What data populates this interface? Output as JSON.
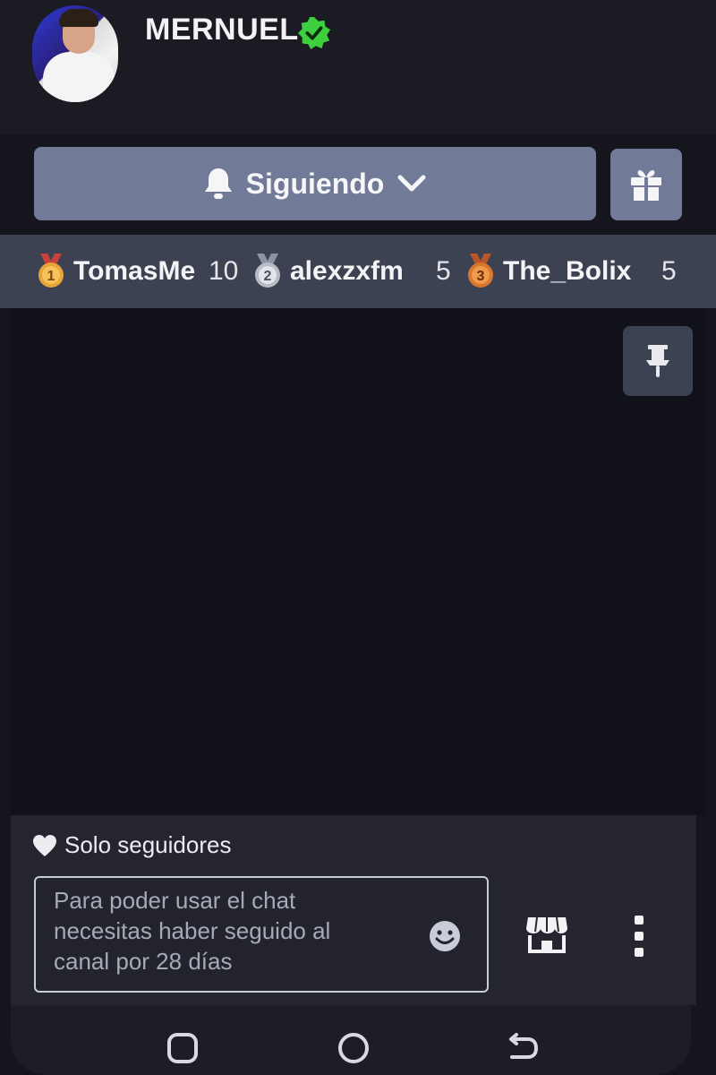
{
  "header": {
    "channel_name": "MERNUEL",
    "verified": true,
    "accent_verified": "#3ecf3e"
  },
  "follow": {
    "label": "Siguiendo",
    "button_color": "#717a97"
  },
  "leaderboard": [
    {
      "rank": 1,
      "name": "TomasMe",
      "count": "10",
      "medal_color": "#e8a43a"
    },
    {
      "rank": 2,
      "name": "alexzxfm",
      "count": "5",
      "medal_color": "#b8bcc6"
    },
    {
      "rank": 3,
      "name": "The_Bolix",
      "count": "5",
      "medal_color": "#d9772f"
    }
  ],
  "chat": {
    "mode_label": "Solo seguidores",
    "placeholder_lines": [
      "Para poder usar el chat",
      "necesitas haber seguido al",
      "canal por 28 días"
    ]
  },
  "icons": {
    "follow": [
      "bell-icon",
      "chevron-down-icon"
    ],
    "gift": "gift-icon",
    "pin": "pin-icon",
    "followers_only": "heart-icon",
    "emoji": "emoji-icon",
    "store": "store-icon",
    "more": "more-vertical-icon",
    "nav": [
      "recent-apps-icon",
      "home-icon",
      "back-icon"
    ]
  }
}
